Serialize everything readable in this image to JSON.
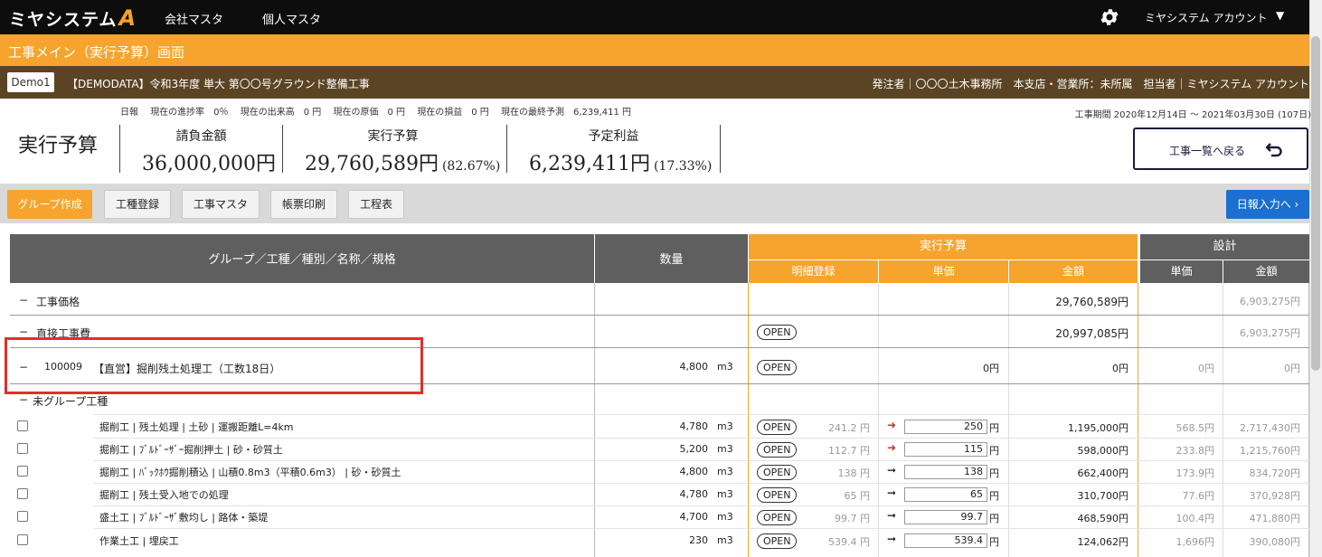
{
  "nav": {
    "logo": "ミヤシステム",
    "logo_a": "A",
    "company_master": "会社マスタ",
    "personal_master": "個人マスタ",
    "account": "ミヤシステム アカウント",
    "caret": "▼"
  },
  "page": {
    "title": "工事メイン（実行予算）画面",
    "demo": "Demo1",
    "project": "【DEMODATA】令和3年度 単大 第〇〇号グラウンド整備工事",
    "client": "発注者｜〇〇〇土木事務所　本支店・営業所：未所属　担当者｜ミヤシステム アカウント"
  },
  "info": {
    "items": [
      "日報",
      "現在の進捗率　0％",
      "現在の出来高　0 円",
      "現在の原価　0 円",
      "現在の損益　0 円",
      "現在の最終予測　6,239,411 円"
    ],
    "period": "工事期間  2020年12月14日 〜 2021年03月30日 (107日)"
  },
  "summary": {
    "title": "実行予算",
    "contract_label": "請負金額",
    "contract_value": "36,000,000円",
    "budget_label": "実行予算",
    "budget_value": "29,760,589円",
    "budget_pct": "(82.67%)",
    "profit_label": "予定利益",
    "profit_value": "6,239,411円",
    "profit_pct": "(17.33%)",
    "back_label": "工事一覧へ戻る"
  },
  "toolbar": {
    "group_create": "グループ作成",
    "process_register": "工種登録",
    "process_master": "工事マスタ",
    "print": "帳票印刷",
    "schedule": "工程表",
    "daily_report": "日報入力へ ›"
  },
  "table": {
    "headers": {
      "name": "グループ／工種／種別／名称／規格",
      "qty": "数量",
      "budget": "実行予算",
      "detail": "明細登録",
      "unit_price": "単価",
      "amount": "金額",
      "design": "設計",
      "design_unit": "単価",
      "design_amount": "金額"
    },
    "open": "OPEN",
    "yen": "円",
    "groups": [
      {
        "toggle": "−",
        "name": "工事価格",
        "amount": "29,760,589円",
        "design_amount": "6,903,275円"
      },
      {
        "toggle": "−",
        "name": "直接工事費",
        "amount": "20,997,085円",
        "design_amount": "6,903,275円"
      },
      {
        "toggle": "−",
        "code": "100009",
        "name": "【直営】掘削残土処理工（工数18日）",
        "qty": "4,800",
        "unit": "m3",
        "unit_price": "0円",
        "amount": "0円",
        "design_unit": "0円",
        "design_amount": "0円"
      },
      {
        "toggle": "−",
        "name": "未グループ工種"
      }
    ],
    "rows": [
      {
        "name": "掘削工 | 残土処理 | 土砂 | 運搬距離L=4km",
        "qty": "4,780",
        "unit": "m3",
        "ref": "241.2 円",
        "arrow": "➜",
        "price": "250",
        "amount": "1,195,000円",
        "d_unit": "568.5円",
        "d_amount": "2,717,430円"
      },
      {
        "name": "掘削工 | ﾌﾞﾙﾄﾞｰｻﾞｰ掘削押土 | 砂・砂質土",
        "qty": "5,200",
        "unit": "m3",
        "ref": "112.7 円",
        "arrow": "➜",
        "price": "115",
        "amount": "598,000円",
        "d_unit": "233.8円",
        "d_amount": "1,215,760円"
      },
      {
        "name": "掘削工 | ﾊﾞｯｸﾎｳ掘削積込 | 山積0.8m3（平積0.6m3） | 砂・砂質土",
        "qty": "4,800",
        "unit": "m3",
        "ref": "138 円",
        "arrow": "➞",
        "price": "138",
        "amount": "662,400円",
        "d_unit": "173.9円",
        "d_amount": "834,720円"
      },
      {
        "name": "掘削工 | 残土受入地での処理",
        "qty": "4,780",
        "unit": "m3",
        "ref": "65 円",
        "arrow": "➞",
        "price": "65",
        "amount": "310,700円",
        "d_unit": "77.6円",
        "d_amount": "370,928円"
      },
      {
        "name": "盛土工 | ﾌﾞﾙﾄﾞｰｻﾞ敷均し | 路体・築堤",
        "qty": "4,700",
        "unit": "m3",
        "ref": "99.7 円",
        "arrow": "➞",
        "price": "99.7",
        "amount": "468,590円",
        "d_unit": "100.4円",
        "d_amount": "471,880円"
      },
      {
        "name": "作業土工 | 埋戻工",
        "qty": "230",
        "unit": "m3",
        "ref": "539.4 円",
        "arrow": "➞",
        "price": "539.4",
        "amount": "124,062円",
        "d_unit": "1,696円",
        "d_amount": "390,080円"
      }
    ]
  }
}
